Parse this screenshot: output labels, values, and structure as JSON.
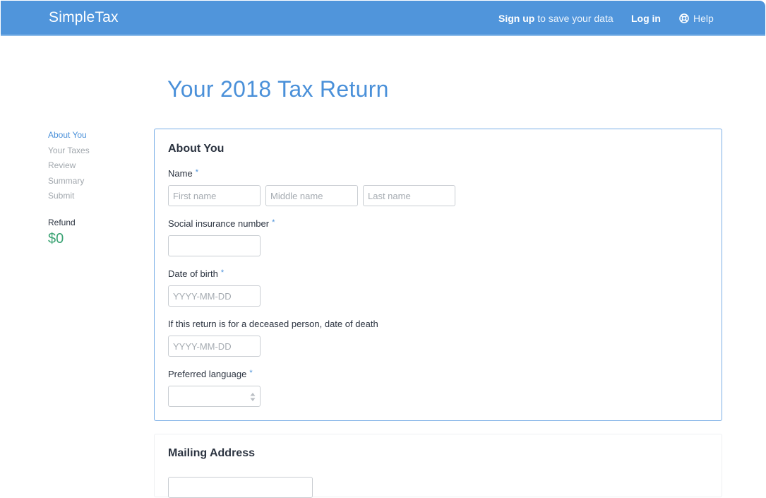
{
  "header": {
    "brand": "SimpleTax",
    "signup_bold": "Sign up",
    "signup_rest": "to save your data",
    "login": "Log in",
    "help": "Help",
    "help_icon": "lifebuoy-icon"
  },
  "page": {
    "title": "Your 2018 Tax Return"
  },
  "sidebar": {
    "items": [
      {
        "label": "About You",
        "active": true
      },
      {
        "label": "Your Taxes",
        "active": false
      },
      {
        "label": "Review",
        "active": false
      },
      {
        "label": "Summary",
        "active": false
      },
      {
        "label": "Submit",
        "active": false
      }
    ],
    "refund_label": "Refund",
    "refund_value": "$0"
  },
  "about_you": {
    "title": "About You",
    "name_label": "Name",
    "required_mark": "*",
    "first_name_placeholder": "First name",
    "middle_name_placeholder": "Middle name",
    "last_name_placeholder": "Last name",
    "sin_label": "Social insurance number",
    "sin_value": "",
    "dob_label": "Date of birth",
    "dob_placeholder": "YYYY-MM-DD",
    "dod_label": "If this return is for a deceased person, date of death",
    "dod_placeholder": "YYYY-MM-DD",
    "language_label": "Preferred language",
    "language_value": ""
  },
  "mailing_address": {
    "title": "Mailing Address"
  },
  "colors": {
    "header_bg": "#5095db",
    "accent": "#4a90d9",
    "refund_green": "#3aa373",
    "muted": "#a1a7ad"
  }
}
